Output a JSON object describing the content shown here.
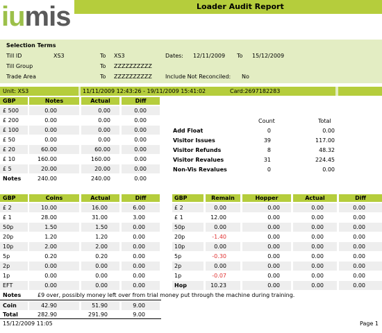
{
  "header": {
    "logo_part1": "iu",
    "logo_part2": "mis",
    "title": "Loader Audit Report"
  },
  "selection": {
    "heading": "Selection Terms",
    "till_id_label": "Till ID",
    "till_id_from": "XS3",
    "to_label": "To",
    "till_id_to": "XS3",
    "dates_label": "Dates:",
    "date_from": "12/11/2009",
    "date_to": "15/12/2009",
    "till_group_label": "Till Group",
    "till_group_to": "ZZZZZZZZZZ",
    "trade_area_label": "Trade Area",
    "trade_area_to": "ZZZZZZZZZZ",
    "include_label": "Include Not Reconciled:",
    "include_value": "No"
  },
  "unit_bar": {
    "unit": "Unit: XS3",
    "period": "11/11/2009 12:43:26 - 19/11/2009 15:41:02",
    "card": "Card:2697182283"
  },
  "notes_table": {
    "headers": [
      "GBP",
      "Notes",
      "Actual",
      "Diff"
    ],
    "rows": [
      [
        "£  500",
        "0.00",
        "0.00",
        "0.00"
      ],
      [
        "£  200",
        "0.00",
        "0.00",
        "0.00"
      ],
      [
        "£  100",
        "0.00",
        "0.00",
        "0.00"
      ],
      [
        "£  50",
        "0.00",
        "0.00",
        "0.00"
      ],
      [
        "£  20",
        "60.00",
        "60.00",
        "0.00"
      ],
      [
        "£  10",
        "160.00",
        "160.00",
        "0.00"
      ],
      [
        "£  5",
        "20.00",
        "20.00",
        "0.00"
      ],
      [
        "Notes",
        "240.00",
        "240.00",
        "0.00"
      ]
    ]
  },
  "summary": {
    "count_header": "Count",
    "total_header": "Total",
    "rows": [
      [
        "Add Float",
        "0",
        "0.00"
      ],
      [
        "Visitor Issues",
        "39",
        "117.00"
      ],
      [
        "Visitor Refunds",
        "8",
        "48.32"
      ],
      [
        "Visitor Revalues",
        "31",
        "224.45"
      ],
      [
        "Non-Vis Revalues",
        "0",
        "0.00"
      ]
    ]
  },
  "coins_table": {
    "headers": [
      "GBP",
      "Coins",
      "Actual",
      "Diff"
    ],
    "rows": [
      [
        "£  2",
        "10.00",
        "16.00",
        "6.00"
      ],
      [
        "£  1",
        "28.00",
        "31.00",
        "3.00"
      ],
      [
        "50p",
        "1.50",
        "1.50",
        "0.00"
      ],
      [
        "20p",
        "1.20",
        "1.20",
        "0.00"
      ],
      [
        "10p",
        "2.00",
        "2.00",
        "0.00"
      ],
      [
        "5p",
        "0.20",
        "0.20",
        "0.00"
      ],
      [
        "2p",
        "0.00",
        "0.00",
        "0.00"
      ],
      [
        "1p",
        "0.00",
        "0.00",
        "0.00"
      ],
      [
        "EFT",
        "0.00",
        "0.00",
        "0.00"
      ]
    ]
  },
  "hopper_table": {
    "headers": [
      "GBP",
      "Remain",
      "Hopper",
      "Actual",
      "Diff"
    ],
    "rows": [
      [
        "£  2",
        "0.00",
        "0.00",
        "0.00",
        "0.00"
      ],
      [
        "£  1",
        "12.00",
        "0.00",
        "0.00",
        "0.00"
      ],
      [
        "50p",
        "0.00",
        "0.00",
        "0.00",
        "0.00"
      ],
      [
        "20p",
        "-1.40",
        "0.00",
        "0.00",
        "0.00"
      ],
      [
        "10p",
        "0.00",
        "0.00",
        "0.00",
        "0.00"
      ],
      [
        "5p",
        "-0.30",
        "0.00",
        "0.00",
        "0.00"
      ],
      [
        "2p",
        "0.00",
        "0.00",
        "0.00",
        "0.00"
      ],
      [
        "1p",
        "-0.07",
        "0.00",
        "0.00",
        "0.00"
      ],
      [
        "Hop",
        "10.23",
        "0.00",
        "0.00",
        "0.00"
      ]
    ],
    "negative_color": "#e03030"
  },
  "notes_line": {
    "label": "Notes",
    "text": "£9 over, possibly money left over from trial money put through the machine during training."
  },
  "totals": {
    "rows": [
      [
        "Coin",
        "42.90",
        "51.90",
        "9.00"
      ],
      [
        "Total",
        "282.90",
        "291.90",
        "9.00"
      ]
    ]
  },
  "footer": {
    "printed": "15/12/2009 11:05",
    "page": "Page 1"
  },
  "colors": {
    "accent": "#b5cd3c",
    "light": "#e3edc3"
  }
}
